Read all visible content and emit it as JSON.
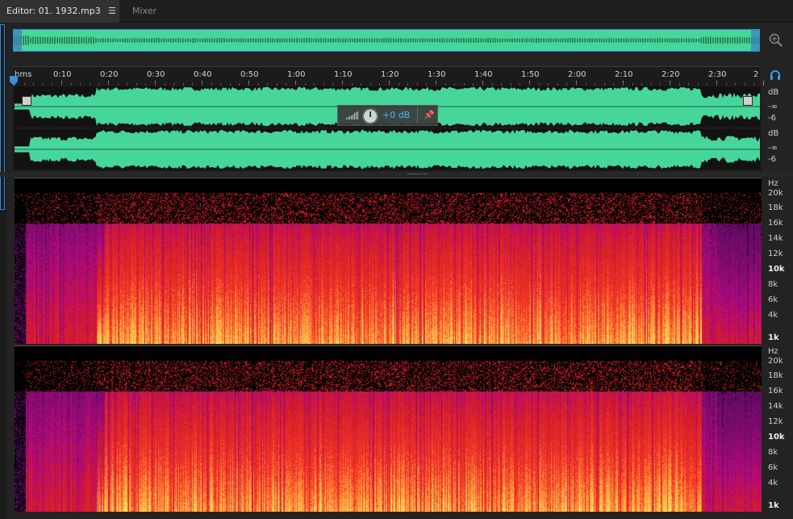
{
  "tabs": {
    "editor_label": "Editor: 01. 1932.mp3",
    "mixer_label": "Mixer"
  },
  "icons": {
    "tab_menu": "hamburger-icon",
    "zoom": "zoom-icon",
    "headphones": "headphone-icon",
    "pin": "pin-icon"
  },
  "ruler": {
    "unit_label": "hms",
    "ticks": [
      "0:10",
      "0:20",
      "0:30",
      "0:40",
      "0:50",
      "1:00",
      "1:10",
      "1:20",
      "1:30",
      "1:40",
      "1:50",
      "2:00",
      "2:10",
      "2:20",
      "2:30",
      "2"
    ]
  },
  "hud": {
    "gain_value": "+0 dB"
  },
  "amplitude_scale": {
    "unit": "dB",
    "labels": [
      "-∞",
      "-6"
    ]
  },
  "frequency_scale": {
    "unit": "Hz",
    "labels": [
      "20k",
      "18k",
      "16k",
      "14k",
      "12k",
      "10k",
      "8k",
      "6k",
      "4k",
      "1k"
    ]
  },
  "colors": {
    "waveform": "#46d69a",
    "selection": "#2d8ae0",
    "gain_text": "#4fb2ff"
  }
}
